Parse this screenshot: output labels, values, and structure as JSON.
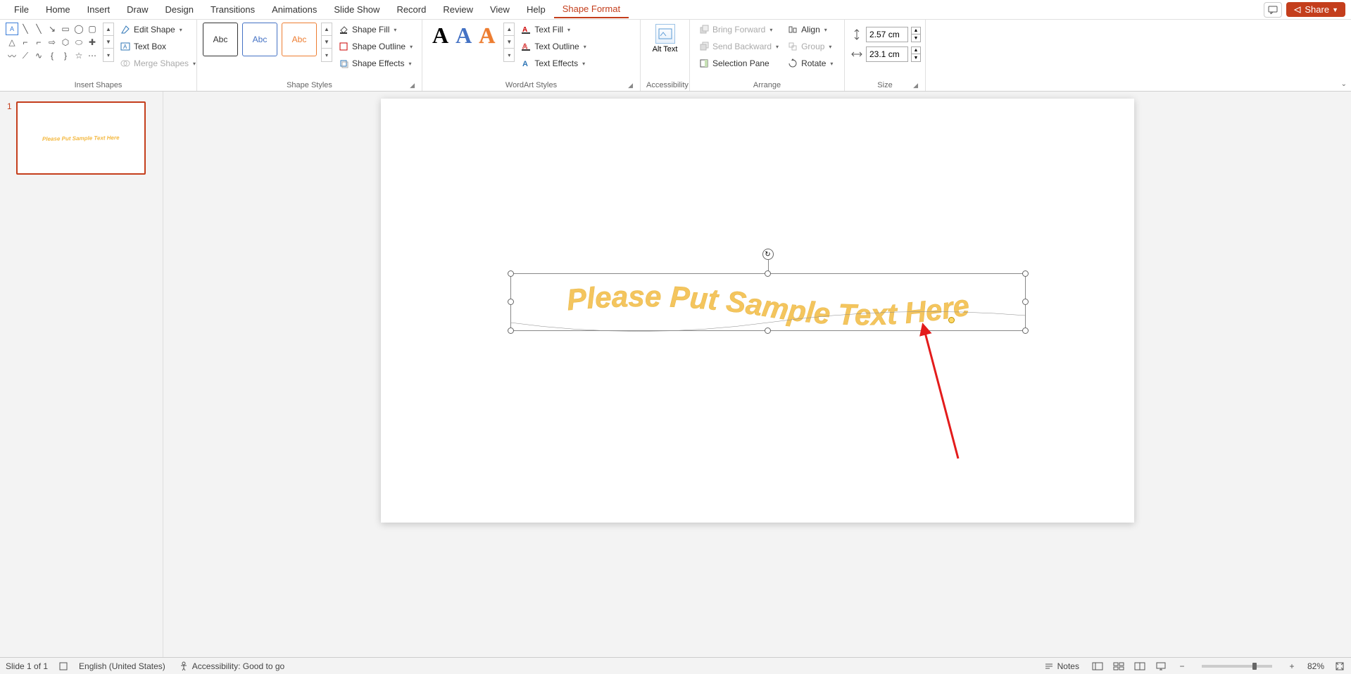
{
  "menu": {
    "tabs": [
      "File",
      "Home",
      "Insert",
      "Draw",
      "Design",
      "Transitions",
      "Animations",
      "Slide Show",
      "Record",
      "Review",
      "View",
      "Help",
      "Shape Format"
    ],
    "active": "Shape Format",
    "share": "Share"
  },
  "ribbon": {
    "insertShapes": {
      "label": "Insert Shapes",
      "editShape": "Edit Shape",
      "textBox": "Text Box",
      "mergeShapes": "Merge Shapes"
    },
    "shapeStyles": {
      "label": "Shape Styles",
      "swatchText": "Abc",
      "shapeFill": "Shape Fill",
      "shapeOutline": "Shape Outline",
      "shapeEffects": "Shape Effects"
    },
    "wordArtStyles": {
      "label": "WordArt Styles",
      "glyph": "A",
      "textFill": "Text Fill",
      "textOutline": "Text Outline",
      "textEffects": "Text Effects"
    },
    "accessibility": {
      "label": "Accessibility",
      "altText": "Alt Text"
    },
    "arrange": {
      "label": "Arrange",
      "bringForward": "Bring Forward",
      "sendBackward": "Send Backward",
      "selectionPane": "Selection Pane",
      "align": "Align",
      "group": "Group",
      "rotate": "Rotate"
    },
    "size": {
      "label": "Size",
      "height": "2.57 cm",
      "width": "23.1 cm"
    }
  },
  "thumbnail": {
    "number": "1",
    "text": "Please Put Sample Text Here"
  },
  "slide": {
    "wordart": "Please Put Sample Text Here"
  },
  "status": {
    "slideInfo": "Slide 1 of 1",
    "language": "English (United States)",
    "accessibility": "Accessibility: Good to go",
    "notes": "Notes",
    "zoom": "82%"
  }
}
